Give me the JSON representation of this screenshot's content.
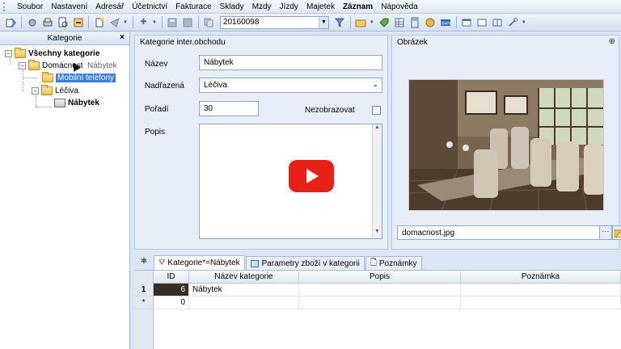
{
  "menu": {
    "items": [
      {
        "label": "Soubor",
        "bold": false
      },
      {
        "label": "Nastavení",
        "bold": false
      },
      {
        "label": "Adresář",
        "bold": false
      },
      {
        "label": "Účetnictví",
        "bold": false
      },
      {
        "label": "Fakturace",
        "bold": false
      },
      {
        "label": "Sklady",
        "bold": false
      },
      {
        "label": "Mzdy",
        "bold": false
      },
      {
        "label": "Jízdy",
        "bold": false
      },
      {
        "label": "Majetek",
        "bold": false
      },
      {
        "label": "Záznam",
        "bold": true
      },
      {
        "label": "Nápověda",
        "bold": false
      }
    ]
  },
  "toolbar": {
    "combo_value": "20160098"
  },
  "left_panel": {
    "title": "Kategorie",
    "close_symbol": "×",
    "tree": {
      "root": "Všechny kategorie",
      "domacnost": "Domácnost",
      "mobilni": "Mobilní telefony",
      "leciva": "Léčiva",
      "nabytek": "Nábytek",
      "drag_label": "Nábytek"
    }
  },
  "category_group": {
    "title": "Kategorie inter.obchodu",
    "name_label": "Název",
    "name_value": "Nábytek",
    "parent_label": "Nadřazená",
    "parent_value": "Léčiva",
    "order_label": "Pořadí",
    "order_value": "30",
    "hide_label": "Nezobrazovat",
    "description_label": "Popis"
  },
  "image_group": {
    "title": "Obrázek",
    "file_name": "domacnost.jpg",
    "dots_label": "···"
  },
  "tabs": [
    {
      "label": "Kategorie*=Nábytek",
      "active": true
    },
    {
      "label": "Parametry zboží v kategorii",
      "active": false
    },
    {
      "label": "Poznámky",
      "active": false
    }
  ],
  "grid": {
    "columns": [
      "ID",
      "Název kategorie",
      "Popis",
      "Poznámka"
    ],
    "rows": [
      {
        "indicator": "1",
        "id": "6",
        "name": "Nábytek",
        "popis": "",
        "poznamka": ""
      },
      {
        "indicator": "*",
        "id": "0",
        "name": "",
        "popis": "",
        "poznamka": ""
      }
    ]
  },
  "colors": {
    "selection": "#3c7fd9",
    "youtube_red": "#e62117"
  }
}
